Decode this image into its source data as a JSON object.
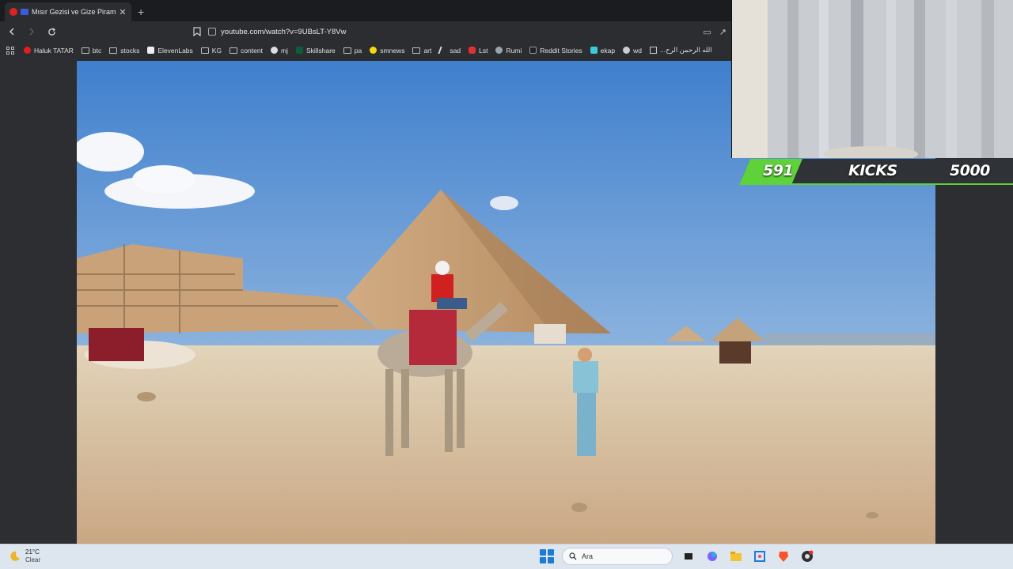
{
  "browser": {
    "tab": {
      "title": "Mısır Gezisi ve Gize Piramitleri",
      "close": "✕"
    },
    "new_tab": "+",
    "address": "youtube.com/watch?v=9UBsLT-Y8Vw",
    "bookmarks": [
      {
        "label": "Haluk TATAR",
        "icon": "youtube-icon"
      },
      {
        "label": "btc",
        "icon": "folder-icon"
      },
      {
        "label": "stocks",
        "icon": "folder-icon"
      },
      {
        "label": "ElevenLabs",
        "icon": "elevenlabs-icon"
      },
      {
        "label": "KG",
        "icon": "folder-icon"
      },
      {
        "label": "content",
        "icon": "folder-icon"
      },
      {
        "label": "mj",
        "icon": "github-icon"
      },
      {
        "label": "Skillshare",
        "icon": "skillshare-icon"
      },
      {
        "label": "pa",
        "icon": "folder-icon"
      },
      {
        "label": "smnews",
        "icon": "smiley-icon"
      },
      {
        "label": "art",
        "icon": "folder-icon"
      },
      {
        "label": "sad",
        "icon": "slash-icon"
      },
      {
        "label": "Lst",
        "icon": "s-icon"
      },
      {
        "label": "Rumi",
        "icon": "globe-icon"
      },
      {
        "label": "Reddit Stories",
        "icon": "d-icon"
      },
      {
        "label": "ekap",
        "icon": "bird-icon"
      },
      {
        "label": "wd",
        "icon": "wordpress-icon"
      },
      {
        "label": "...الله الرحمن الرح",
        "icon": "doc-icon"
      }
    ]
  },
  "overlay": {
    "kicks_current": "591",
    "kicks_label": "KICKS",
    "kicks_goal": "5000",
    "accent_color": "#5fd13a"
  },
  "taskbar": {
    "temperature": "21°C",
    "condition": "Clear",
    "search_placeholder": "Ara"
  }
}
